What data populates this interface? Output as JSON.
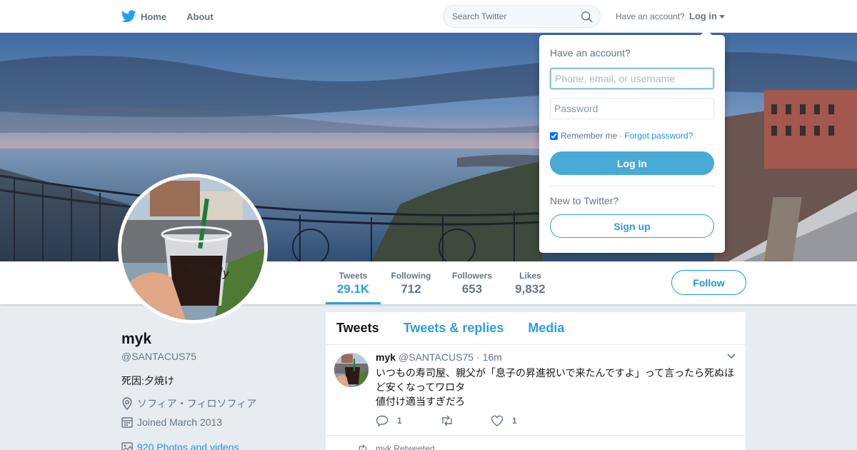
{
  "nav": {
    "home_label": "Home",
    "about_label": "About",
    "search_placeholder": "Search Twitter",
    "have_account": "Have an account?",
    "login_label": "Log in"
  },
  "profile": {
    "name": "myk",
    "handle": "@SANTACUS75",
    "bio": "死因:夕焼け",
    "location": "ソフィア・フィロソフィア",
    "joined": "Joined March 2013",
    "photos": "920 Photos and videos"
  },
  "stats": [
    {
      "label": "Tweets",
      "value": "29.1K"
    },
    {
      "label": "Following",
      "value": "712"
    },
    {
      "label": "Followers",
      "value": "653"
    },
    {
      "label": "Likes",
      "value": "9,832"
    }
  ],
  "follow_label": "Follow",
  "timeline": {
    "tabs": [
      "Tweets",
      "Tweets & replies",
      "Media"
    ],
    "tweet": {
      "name": "myk",
      "handle": "@SANTACUS75",
      "dot": "·",
      "time": "16m",
      "line1": "いつもの寿司屋、親父が「息子の昇進祝いで来たんですよ」って言ったら死ぬほど安くなってワロタ",
      "line2": "値付け適当すぎだろ",
      "reply_count": "1",
      "like_count": "1"
    },
    "retweeted_label": "myk Retweeted"
  },
  "login_dropdown": {
    "title": "Have an account?",
    "username_placeholder": "Phone, email, or username",
    "password_placeholder": "Password",
    "remember": "Remember me",
    "separator": "·",
    "forgot": "Forgot password?",
    "login_button": "Log in",
    "new_to": "New to Twitter?",
    "signup_button": "Sign up"
  },
  "colors": {
    "accent": "#1b95e0",
    "login_button": "#48aad6",
    "background": "#e6ecf0"
  }
}
